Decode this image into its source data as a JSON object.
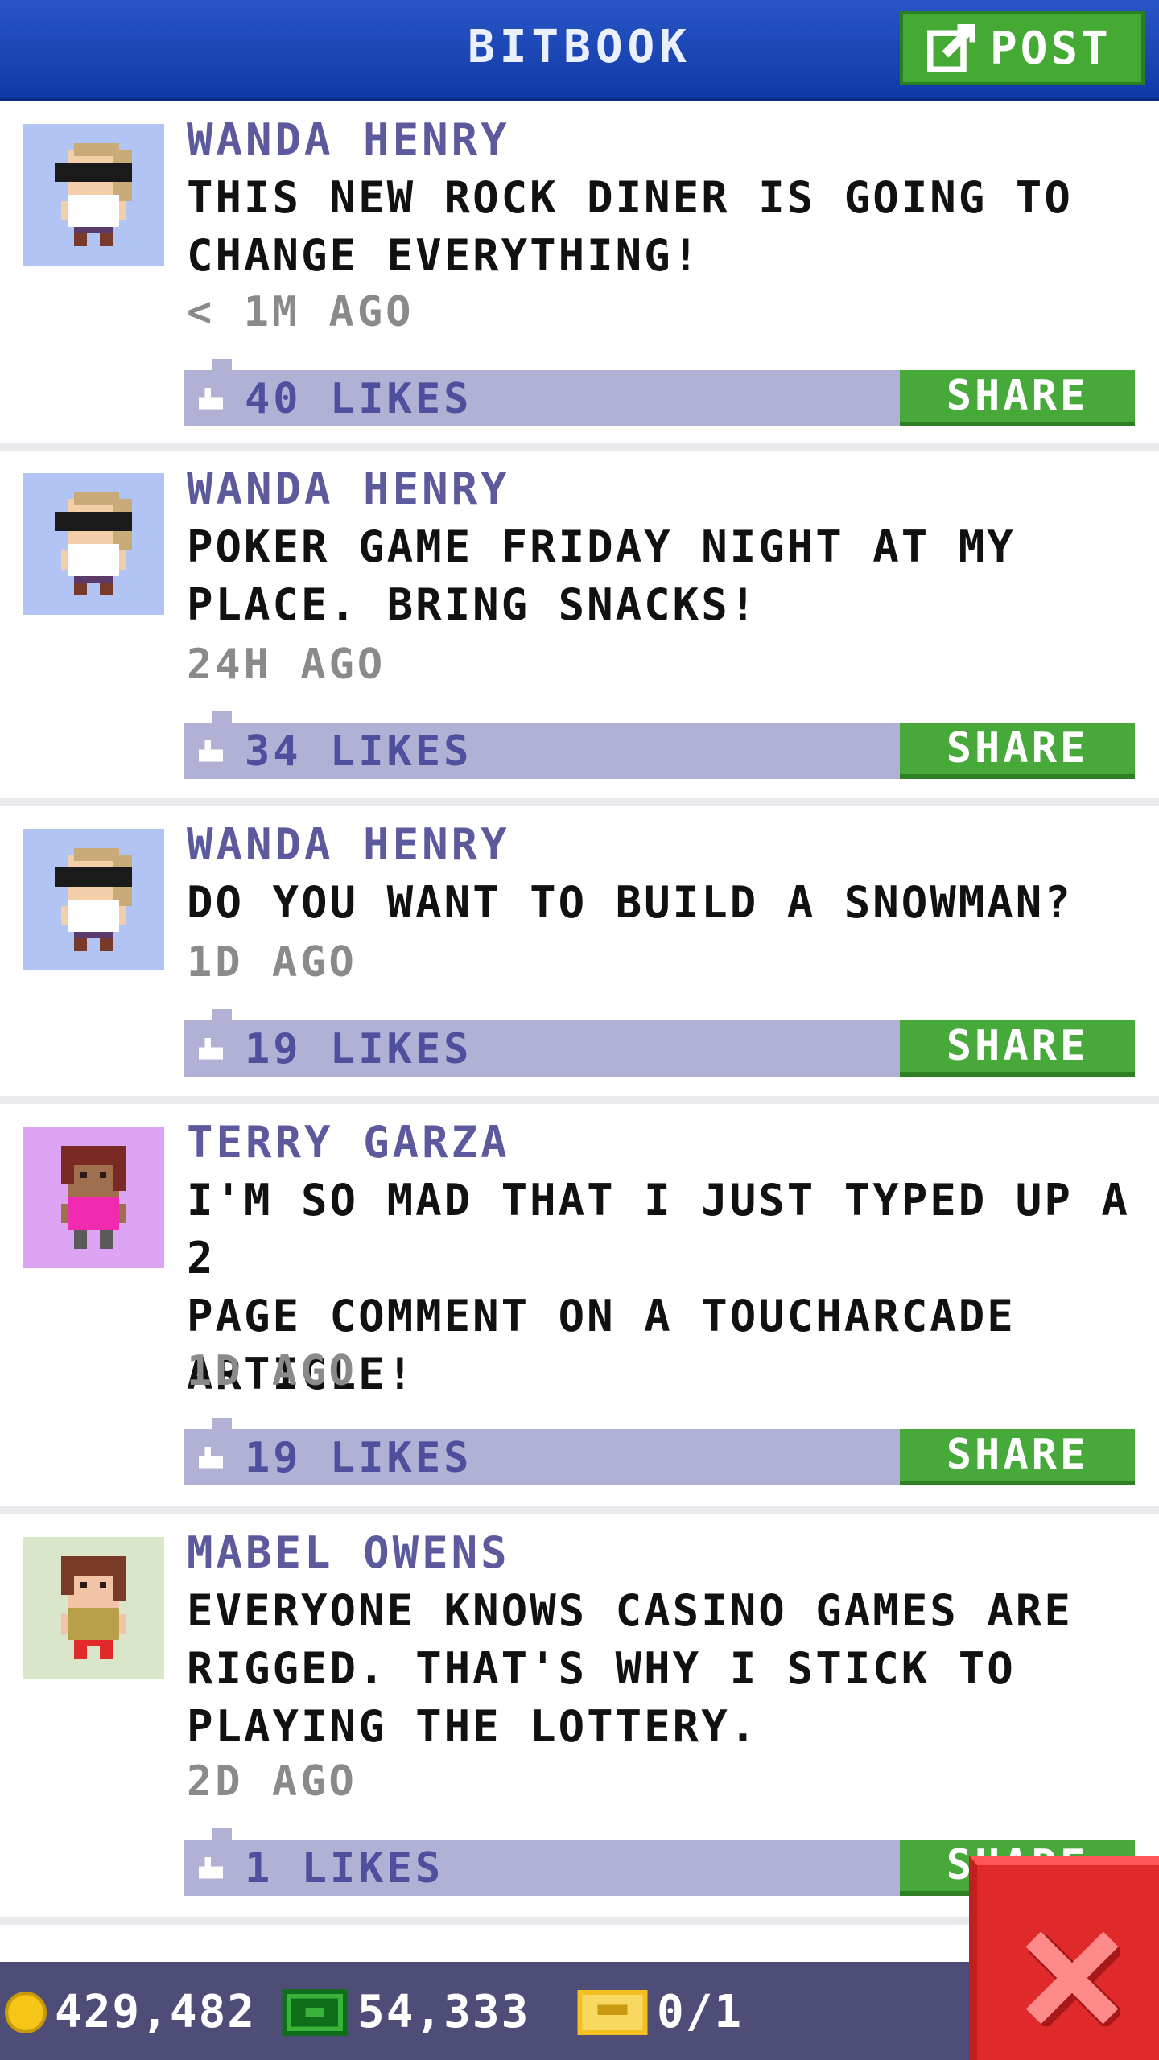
{
  "header": {
    "title": "BITBOOK",
    "post_label": "POST"
  },
  "posts": [
    {
      "name": "WANDA HENRY",
      "lines": [
        "THIS NEW ROCK DINER IS GOING TO",
        "CHANGE EVERYTHING!"
      ],
      "time": "< 1M AGO",
      "likes": "40 LIKES",
      "share": "SHARE",
      "avatar": "wanda-avatar"
    },
    {
      "name": "WANDA HENRY",
      "lines": [
        "POKER GAME FRIDAY NIGHT AT MY",
        "PLACE. BRING SNACKS!"
      ],
      "time": "24H AGO",
      "likes": "34 LIKES",
      "share": "SHARE",
      "avatar": "wanda-avatar"
    },
    {
      "name": "WANDA HENRY",
      "lines": [
        "DO YOU WANT TO BUILD A SNOWMAN?"
      ],
      "time": "1D AGO",
      "likes": "19 LIKES",
      "share": "SHARE",
      "avatar": "wanda-avatar"
    },
    {
      "name": "TERRY GARZA",
      "lines": [
        "I'M SO MAD THAT I JUST TYPED UP A 2",
        "PAGE COMMENT ON A TOUCHARCADE",
        "ARTICLE!"
      ],
      "time": "1D AGO",
      "likes": "19 LIKES",
      "share": "SHARE",
      "avatar": "terry-avatar"
    },
    {
      "name": "MABEL OWENS",
      "lines": [
        "EVERYONE KNOWS CASINO GAMES ARE",
        "RIGGED. THAT'S WHY I STICK TO",
        "PLAYING THE LOTTERY."
      ],
      "time": "2D AGO",
      "likes": "1 LIKES",
      "share": "SHARE",
      "avatar": "mabel-avatar"
    }
  ],
  "stats": {
    "coins": "429,482",
    "bux": "54,333",
    "tickets": "0/1"
  },
  "colors": {
    "header": "#1d47b8",
    "accent_green": "#46a93a",
    "likes_bar": "#b1b1d6",
    "bottom_bar": "#4d4d78",
    "close_red": "#e0292b"
  }
}
